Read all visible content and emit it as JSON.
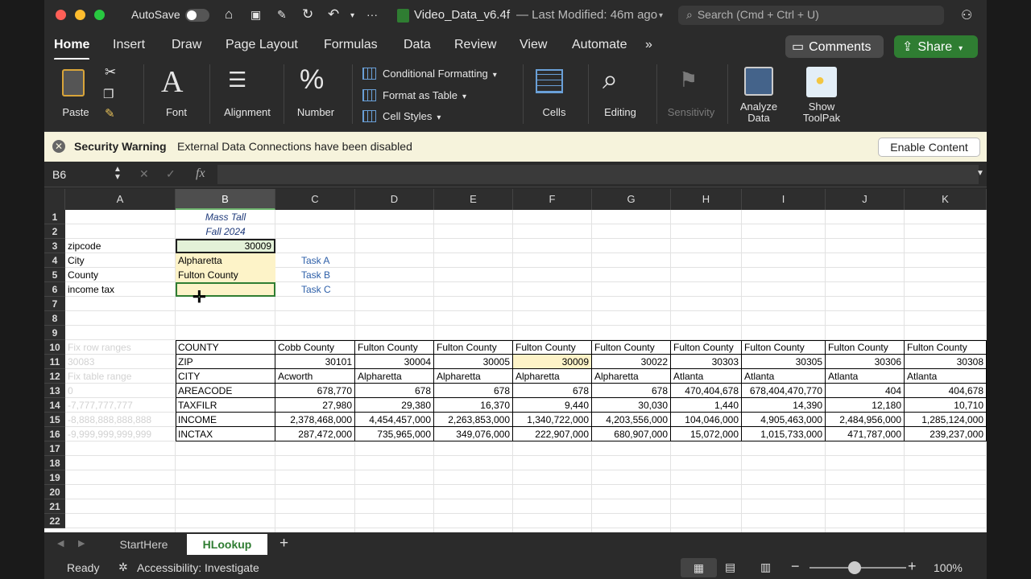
{
  "titlebar": {
    "autosave_label": "AutoSave",
    "filename": "Video_Data_v6.4f",
    "modified": "— Last Modified: 46m ago",
    "search_placeholder": "Search (Cmd + Ctrl + U)"
  },
  "tabs": [
    "Home",
    "Insert",
    "Draw",
    "Page Layout",
    "Formulas",
    "Data",
    "Review",
    "View",
    "Automate"
  ],
  "more_tabs": "»",
  "buttons": {
    "comments": "Comments",
    "share": "Share"
  },
  "ribbon": {
    "paste": "Paste",
    "font": "Font",
    "alignment": "Alignment",
    "number": "Number",
    "conditional_formatting": "Conditional Formatting",
    "format_as_table": "Format as Table",
    "cell_styles": "Cell Styles",
    "cells": "Cells",
    "editing": "Editing",
    "sensitivity": "Sensitivity",
    "analyze_data": "Analyze Data",
    "show_toolpak": "Show ToolPak"
  },
  "security": {
    "title": "Security Warning",
    "message": "External Data Connections have been disabled",
    "enable": "Enable Content"
  },
  "formula_bar": {
    "name_box": "B6",
    "fx": "fx",
    "value": ""
  },
  "columns": [
    "A",
    "B",
    "C",
    "D",
    "E",
    "F",
    "G",
    "H",
    "I",
    "J",
    "K"
  ],
  "rows": [
    "1",
    "2",
    "3",
    "4",
    "5",
    "6",
    "7",
    "8",
    "9",
    "10",
    "11",
    "12",
    "13",
    "14",
    "15",
    "16",
    "17",
    "18",
    "19",
    "20",
    "21",
    "22"
  ],
  "sheet": {
    "b1": "Mass Tall",
    "b2": "Fall 2024",
    "a3": "zipcode",
    "b3": "30009",
    "a4": "City",
    "b4": "Alpharetta",
    "c4": "Task A",
    "a5": "County",
    "b5": "Fulton County",
    "c5": "Task B",
    "a6": "income tax",
    "c6": "Task C",
    "a10": "Fix row ranges",
    "a11": "30083",
    "a12": "Fix table range",
    "a13": "0",
    "a14": "-7,777,777,777",
    "a15": "-8,888,888,888,888",
    "a16": "-9,999,999,999,999"
  },
  "table": {
    "labels": [
      "COUNTY",
      "ZIP",
      "CITY",
      "AREACODE",
      "TAXFILR",
      "INCOME",
      "INCTAX"
    ],
    "columns": [
      [
        "Cobb County",
        "30101",
        "Acworth",
        "678,770",
        "27,980",
        "2,378,468,000",
        "287,472,000"
      ],
      [
        "Fulton County",
        "30004",
        "Alpharetta",
        "678",
        "29,380",
        "4,454,457,000",
        "735,965,000"
      ],
      [
        "Fulton County",
        "30005",
        "Alpharetta",
        "678",
        "16,370",
        "2,263,853,000",
        "349,076,000"
      ],
      [
        "Fulton County",
        "30009",
        "Alpharetta",
        "678",
        "9,440",
        "1,340,722,000",
        "222,907,000"
      ],
      [
        "Fulton County",
        "30022",
        "Alpharetta",
        "678",
        "30,030",
        "4,203,556,000",
        "680,907,000"
      ],
      [
        "Fulton County",
        "30303",
        "Atlanta",
        "470,404,678",
        "1,440",
        "104,046,000",
        "15,072,000"
      ],
      [
        "Fulton County",
        "30305",
        "Atlanta",
        "678,404,470,770",
        "14,390",
        "4,905,463,000",
        "1,015,733,000"
      ],
      [
        "Fulton County",
        "30306",
        "Atlanta",
        "404",
        "12,180",
        "2,484,956,000",
        "471,787,000"
      ],
      [
        "Fulton County",
        "30308",
        "Atlanta",
        "404,678",
        "10,710",
        "1,285,124,000",
        "239,237,000"
      ]
    ]
  },
  "sheet_tabs": [
    "StartHere",
    "HLookup"
  ],
  "add_sheet": "+",
  "status": {
    "ready": "Ready",
    "accessibility": "Accessibility: Investigate",
    "zoom": "100%"
  }
}
